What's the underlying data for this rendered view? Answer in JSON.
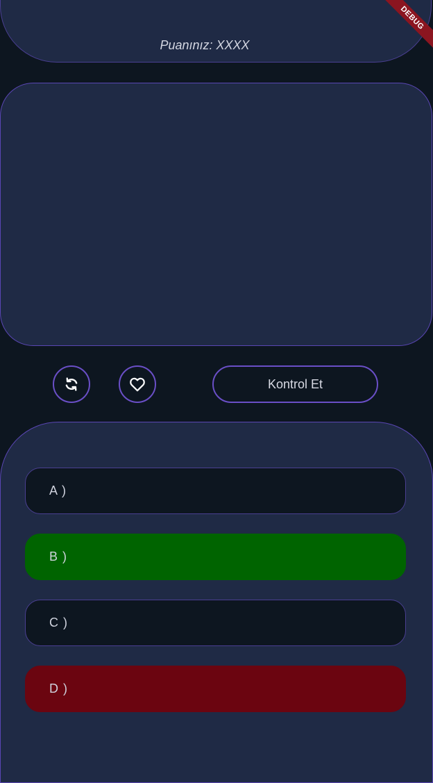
{
  "score": {
    "text": "Puanınız: XXXX"
  },
  "debug_banner": {
    "label": "DEBUG"
  },
  "controls": {
    "refresh_icon": "refresh-icon",
    "heart_icon": "heart-icon",
    "check_label": "Kontrol Et"
  },
  "answers": [
    {
      "label": "A )",
      "state": "neutral"
    },
    {
      "label": "B )",
      "state": "correct"
    },
    {
      "label": "C )",
      "state": "neutral"
    },
    {
      "label": "D )",
      "state": "wrong"
    }
  ],
  "colors": {
    "background": "#0d1620",
    "panel": "#1f2a45",
    "accent_border": "#6a4fc7",
    "correct": "#006400",
    "wrong": "#6b0510"
  }
}
